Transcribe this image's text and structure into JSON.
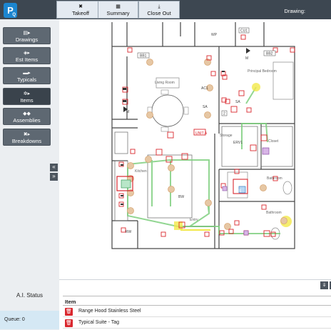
{
  "topbar": {
    "buttons": [
      {
        "label": "Takeoff",
        "icon": "crossed-tools-icon",
        "glyph": "✖"
      },
      {
        "label": "Summary",
        "icon": "calculator-icon",
        "glyph": "▦"
      },
      {
        "label": "Close Out",
        "icon": "download-icon",
        "glyph": "⤓"
      }
    ],
    "drawing_label": "Drawing:"
  },
  "sidebar": {
    "items": [
      {
        "label": "Drawings",
        "icon": "file-icon",
        "glyph": "▤▸"
      },
      {
        "label": "Est Items",
        "icon": "gear-icon",
        "glyph": "◈▸"
      },
      {
        "label": "Typicals",
        "icon": "folder-icon",
        "glyph": "▬▸"
      },
      {
        "label": "Items",
        "icon": "gear-icon",
        "glyph": "✲▸",
        "active": true
      },
      {
        "label": "Assemblies",
        "icon": "cubes-icon",
        "glyph": "◆◆"
      },
      {
        "label": "Breakdowns",
        "icon": "crossed-tools-icon",
        "glyph": "✖▸"
      }
    ],
    "collapse_glyph": "«",
    "expand_glyph": "»",
    "ai_status": "A.I. Status",
    "queue": "Queue: 0"
  },
  "floorplan": {
    "rooms": {
      "living_room": "Living Room",
      "principal_bedroom": "Principal Bedroom",
      "kitchen": "Kitchen",
      "storage": "Storage",
      "closet": "Closet",
      "bathroom_1": "Bathroom",
      "bathroom_2": "Bathroom",
      "entry": "Entry"
    },
    "tags": {
      "cu1": "CU1",
      "wp": "WP",
      "bb1": "BB1",
      "bb2": "BB2",
      "ac1": "AC1",
      "sa1": "SA",
      "sa2": "SA",
      "m1": "M",
      "m2": "M",
      "bw": "BW",
      "erv1": "ERV1",
      "ef6": "EF6",
      "unit_a": "UNIT A",
      "rw": "RW",
      "n2": "2"
    }
  },
  "bottom": {
    "column_header": "Item",
    "rows": [
      {
        "name": "Range Hood Stainless Steel"
      },
      {
        "name": "Typical Suite - Tag"
      },
      {
        "name": ""
      }
    ],
    "pan_glyph": "⇓"
  },
  "colors": {
    "accent": "#1c86d0",
    "topbar": "#3d4751",
    "sidebar_button": "#5e6872",
    "circuit_green": "#7fd07f",
    "highlight_yellow": "#f2e84a",
    "device_red": "#d9272e",
    "device_tan": "#d9a877"
  }
}
